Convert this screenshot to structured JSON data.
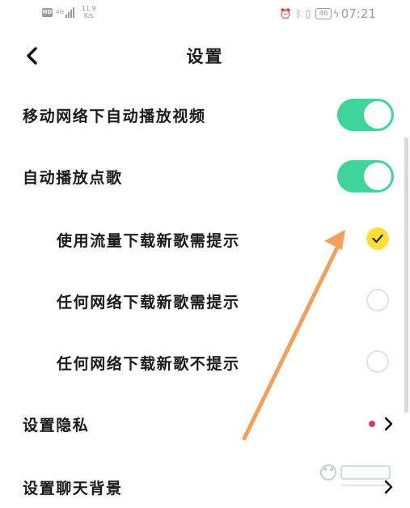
{
  "status_bar": {
    "hd": "HD",
    "network_type": "4G",
    "speed_value": "11.9",
    "speed_unit": "K/s",
    "battery": "46",
    "time": "07:21"
  },
  "header": {
    "title": "设置"
  },
  "settings": {
    "autoplay_video": {
      "label": "移动网络下自动播放视频",
      "enabled": true
    },
    "autoplay_song": {
      "label": "自动播放点歌",
      "enabled": true
    },
    "download_options": [
      {
        "label": "使用流量下载新歌需提示",
        "selected": true
      },
      {
        "label": "任何网络下载新歌需提示",
        "selected": false
      },
      {
        "label": "任何网络下载新歌不提示",
        "selected": false
      }
    ],
    "privacy": {
      "label": "设置隐私",
      "has_badge": true
    },
    "chat_background": {
      "label": "设置聊天背景"
    }
  },
  "colors": {
    "toggle_on": "#3ed59a",
    "radio_selected": "#ffe03a",
    "badge": "#e8336e",
    "annotation_arrow": "#f2a05c"
  },
  "icons": {
    "back": "chevron-left-icon",
    "next": "chevron-right-icon",
    "check": "check-icon"
  }
}
